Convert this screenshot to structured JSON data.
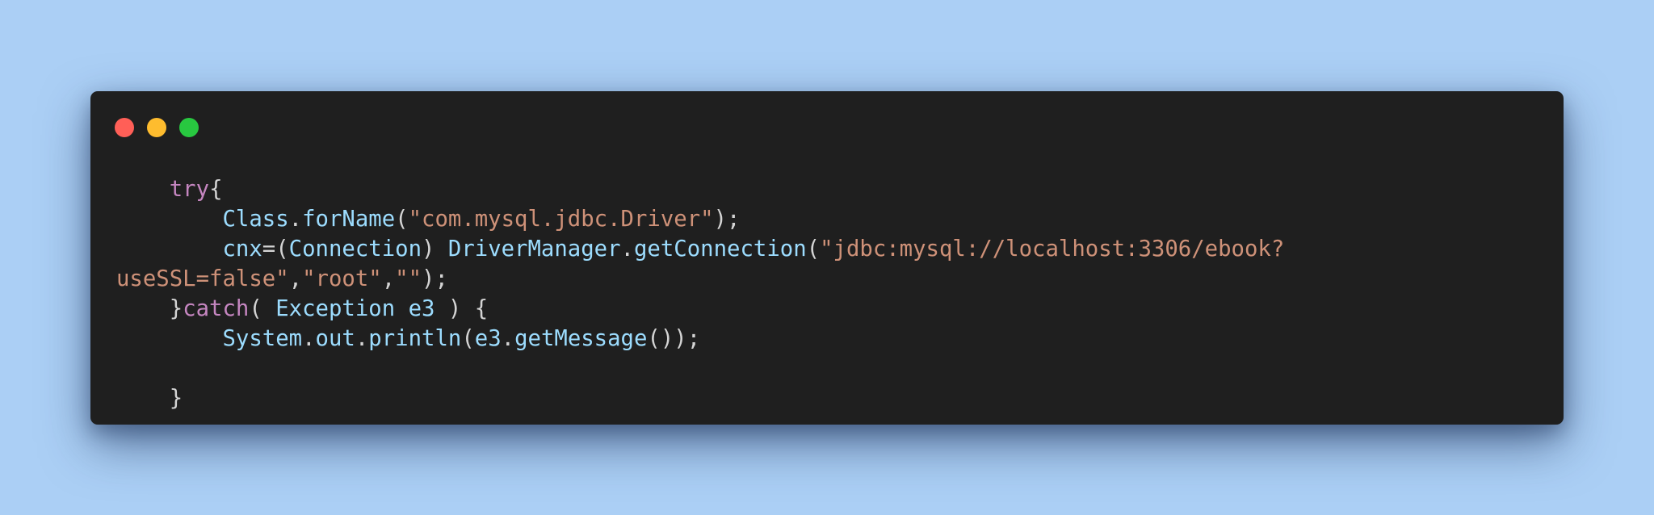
{
  "window": {
    "buttons": {
      "close_color": "#ff5f57",
      "minimize_color": "#febc2e",
      "maximize_color": "#28c840"
    }
  },
  "code": {
    "language": "java",
    "lines": [
      [
        {
          "t": "    ",
          "c": "pun"
        },
        {
          "t": "try",
          "c": "kw"
        },
        {
          "t": "{",
          "c": "pun"
        }
      ],
      [
        {
          "t": "        ",
          "c": "pun"
        },
        {
          "t": "Class",
          "c": "cls"
        },
        {
          "t": ".",
          "c": "pun"
        },
        {
          "t": "forName",
          "c": "fn"
        },
        {
          "t": "(",
          "c": "pun"
        },
        {
          "t": "\"com.mysql.jdbc.Driver\"",
          "c": "str"
        },
        {
          "t": ");",
          "c": "pun"
        }
      ],
      [
        {
          "t": "        ",
          "c": "pun"
        },
        {
          "t": "cnx",
          "c": "cls"
        },
        {
          "t": "=(",
          "c": "pun"
        },
        {
          "t": "Connection",
          "c": "cls"
        },
        {
          "t": ") ",
          "c": "pun"
        },
        {
          "t": "DriverManager",
          "c": "cls"
        },
        {
          "t": ".",
          "c": "pun"
        },
        {
          "t": "getConnection",
          "c": "fn"
        },
        {
          "t": "(",
          "c": "pun"
        },
        {
          "t": "\"jdbc:mysql://localhost:3306/ebook?",
          "c": "str"
        }
      ],
      [
        {
          "t": "useSSL=false\"",
          "c": "str"
        },
        {
          "t": ",",
          "c": "pun"
        },
        {
          "t": "\"root\"",
          "c": "str"
        },
        {
          "t": ",",
          "c": "pun"
        },
        {
          "t": "\"\"",
          "c": "str"
        },
        {
          "t": ");",
          "c": "pun"
        }
      ],
      [
        {
          "t": "    ",
          "c": "pun"
        },
        {
          "t": "}",
          "c": "pun"
        },
        {
          "t": "catch",
          "c": "kw"
        },
        {
          "t": "( ",
          "c": "pun"
        },
        {
          "t": "Exception",
          "c": "cls"
        },
        {
          "t": " ",
          "c": "pun"
        },
        {
          "t": "e3",
          "c": "cls"
        },
        {
          "t": " ) {",
          "c": "pun"
        }
      ],
      [
        {
          "t": "        ",
          "c": "pun"
        },
        {
          "t": "System",
          "c": "cls"
        },
        {
          "t": ".",
          "c": "pun"
        },
        {
          "t": "out",
          "c": "cls"
        },
        {
          "t": ".",
          "c": "pun"
        },
        {
          "t": "println",
          "c": "fn"
        },
        {
          "t": "(",
          "c": "pun"
        },
        {
          "t": "e3",
          "c": "cls"
        },
        {
          "t": ".",
          "c": "pun"
        },
        {
          "t": "getMessage",
          "c": "fn"
        },
        {
          "t": "());",
          "c": "pun"
        }
      ],
      [],
      [
        {
          "t": "    ",
          "c": "pun"
        },
        {
          "t": "}",
          "c": "pun"
        }
      ]
    ]
  }
}
